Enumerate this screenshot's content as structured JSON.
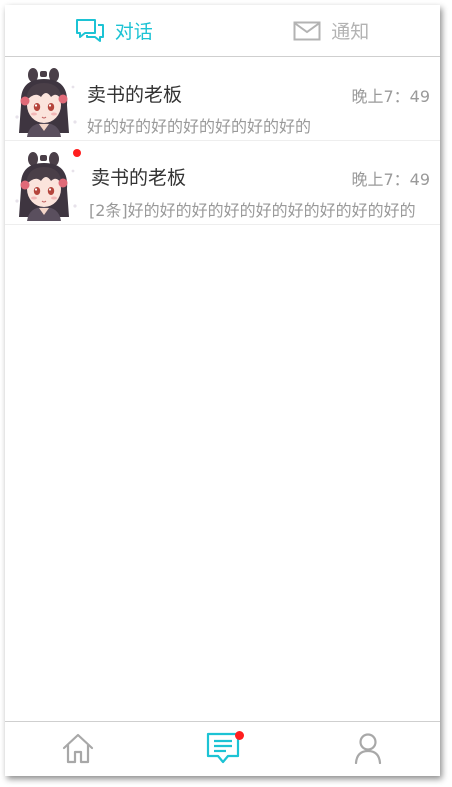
{
  "tabs": [
    {
      "label": "对话",
      "active": true,
      "icon": "chat-icon"
    },
    {
      "label": "通知",
      "active": false,
      "icon": "mail-icon"
    }
  ],
  "conversations": [
    {
      "name": "卖书的老板",
      "time": "晚上7：49",
      "preview": "好的好的好的好的好的好的好的",
      "unread": false,
      "avatar": "anime-girl-avatar"
    },
    {
      "name": "卖书的老板",
      "time": "晚上7：49",
      "preview": "[2条]好的好的好的好的好的好的好的好的好的",
      "unread": true,
      "avatar": "anime-girl-avatar"
    }
  ],
  "bottom_nav": [
    {
      "icon": "home-icon",
      "active": false
    },
    {
      "icon": "message-icon",
      "active": true,
      "badge": true
    },
    {
      "icon": "user-icon",
      "active": false
    }
  ],
  "colors": {
    "accent": "#1cc3d4",
    "inactive": "#b3b3b3",
    "badge": "#ff1e1e",
    "text_primary": "#333333",
    "text_secondary": "#9a9a9a"
  }
}
